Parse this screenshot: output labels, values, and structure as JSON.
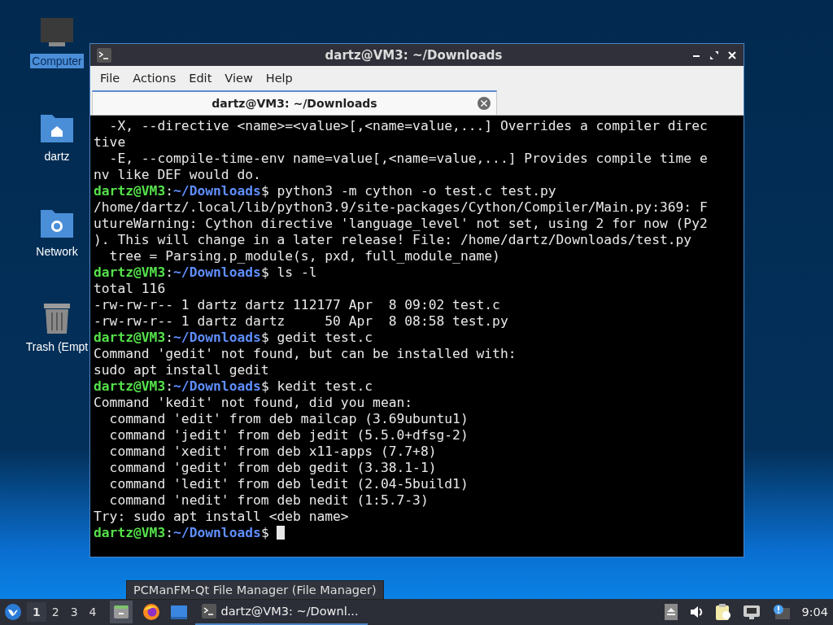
{
  "desktop_icons": [
    {
      "label": "Computer",
      "kind": "computer",
      "selected": true
    },
    {
      "label": "dartz",
      "kind": "home",
      "selected": false
    },
    {
      "label": "Network",
      "kind": "network",
      "selected": false
    },
    {
      "label": "Trash (Empt",
      "kind": "trash",
      "selected": false
    }
  ],
  "window": {
    "title": "dartz@VM3: ~/Downloads",
    "menu": [
      "File",
      "Actions",
      "Edit",
      "View",
      "Help"
    ],
    "tabs": [
      {
        "label": "dartz@VM3: ~/Downloads",
        "selected": true
      }
    ],
    "terminal_lines": [
      {
        "kind": "output",
        "text": "  -X, --directive <name>=<value>[,<name=value,...] Overrides a compiler direc"
      },
      {
        "kind": "output",
        "text": "tive"
      },
      {
        "kind": "output",
        "text": "  -E, --compile-time-env name=value[,<name=value,...] Provides compile time e"
      },
      {
        "kind": "output",
        "text": "nv like DEF would do."
      },
      {
        "kind": "prompt",
        "user": "dartz@VM3",
        "path": "~/Downloads",
        "command": "$ python3 -m cython -o test.c test.py",
        "separator": ":"
      },
      {
        "kind": "output",
        "text": "/home/dartz/.local/lib/python3.9/site-packages/Cython/Compiler/Main.py:369: F"
      },
      {
        "kind": "output",
        "text": "utureWarning: Cython directive 'language_level' not set, using 2 for now (Py2"
      },
      {
        "kind": "output",
        "text": "). This will change in a later release! File: /home/dartz/Downloads/test.py"
      },
      {
        "kind": "output",
        "text": "  tree = Parsing.p_module(s, pxd, full_module_name)"
      },
      {
        "kind": "prompt",
        "user": "dartz@VM3",
        "path": "~/Downloads",
        "command": "$ ls -l",
        "separator": ":"
      },
      {
        "kind": "output",
        "text": "total 116"
      },
      {
        "kind": "output",
        "text": "-rw-rw-r-- 1 dartz dartz 112177 Apr  8 09:02 test.c"
      },
      {
        "kind": "output",
        "text": "-rw-rw-r-- 1 dartz dartz     50 Apr  8 08:58 test.py"
      },
      {
        "kind": "prompt",
        "user": "dartz@VM3",
        "path": "~/Downloads",
        "command": "$ gedit test.c",
        "separator": ":"
      },
      {
        "kind": "output",
        "text": "Command 'gedit' not found, but can be installed with:"
      },
      {
        "kind": "output",
        "text": "sudo apt install gedit"
      },
      {
        "kind": "prompt",
        "user": "dartz@VM3",
        "path": "~/Downloads",
        "command": "$ kedit test.c",
        "separator": ":"
      },
      {
        "kind": "output",
        "text": "Command 'kedit' not found, did you mean:"
      },
      {
        "kind": "output",
        "text": "  command 'edit' from deb mailcap (3.69ubuntu1)"
      },
      {
        "kind": "output",
        "text": "  command 'jedit' from deb jedit (5.5.0+dfsg-2)"
      },
      {
        "kind": "output",
        "text": "  command 'xedit' from deb x11-apps (7.7+8)"
      },
      {
        "kind": "output",
        "text": "  command 'gedit' from deb gedit (3.38.1-1)"
      },
      {
        "kind": "output",
        "text": "  command 'ledit' from deb ledit (2.04-5build1)"
      },
      {
        "kind": "output",
        "text": "  command 'nedit' from deb nedit (1:5.7-3)"
      },
      {
        "kind": "output",
        "text": "Try: sudo apt install <deb name>"
      },
      {
        "kind": "prompt",
        "user": "dartz@VM3",
        "path": "~/Downloads",
        "command": "$ ",
        "separator": ":",
        "cursor": true
      }
    ]
  },
  "tooltip": "PCManFM-Qt File Manager (File Manager)",
  "taskbar": {
    "workspaces": [
      {
        "label": "1",
        "selected": true
      },
      {
        "label": "2",
        "selected": false
      },
      {
        "label": "3",
        "selected": false
      },
      {
        "label": "4",
        "selected": false
      }
    ],
    "tasks": [
      {
        "label": "dartz@VM3: ~/Downl...",
        "selected": true
      }
    ],
    "clock": "9:04"
  }
}
